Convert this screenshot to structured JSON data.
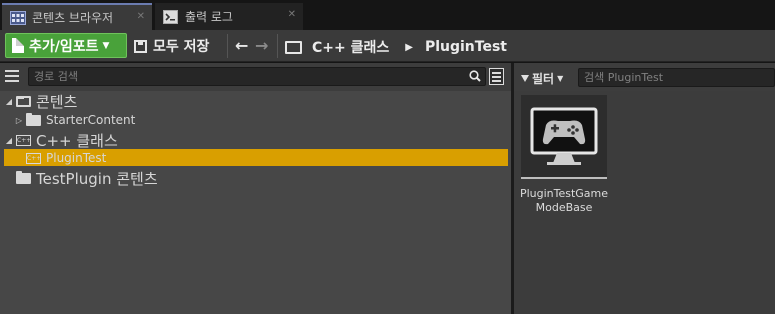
{
  "tabs": [
    {
      "label": "콘텐츠 브라우저",
      "icon": "content-browser-icon",
      "active": true
    },
    {
      "label": "출력 로그",
      "icon": "output-log-icon",
      "active": false
    }
  ],
  "toolbar": {
    "add_import_label": "추가/임포트",
    "save_all_label": "모두 저장",
    "path": [
      "C++ 클래스",
      "PluginTest"
    ]
  },
  "sources": {
    "search_placeholder": "경로 검색",
    "tree": [
      {
        "label": "콘텐츠",
        "level": 0,
        "expanded": true,
        "icon": "folder-open-icon"
      },
      {
        "label": "StarterContent",
        "level": 1,
        "expanded": false,
        "icon": "folder-icon"
      },
      {
        "label": "C++ 클래스",
        "level": 0,
        "expanded": true,
        "icon": "cpp-folder-icon"
      },
      {
        "label": "PluginTest",
        "level": 1,
        "expanded": false,
        "icon": "cpp-folder-icon",
        "selected": true
      },
      {
        "label": "TestPlugin 콘텐츠",
        "level": 0,
        "expanded": false,
        "icon": "folder-icon"
      }
    ]
  },
  "assets": {
    "filter_label": "필터",
    "search_placeholder": "검색 PluginTest",
    "items": [
      {
        "name": "PluginTestGameModeBase",
        "name_line1": "PluginTestGame",
        "name_line2": "ModeBase",
        "icon": "gamepad-icon"
      }
    ]
  },
  "colors": {
    "accent_green": "#49a23a",
    "selection": "#d99f00",
    "panel": "#474747"
  }
}
